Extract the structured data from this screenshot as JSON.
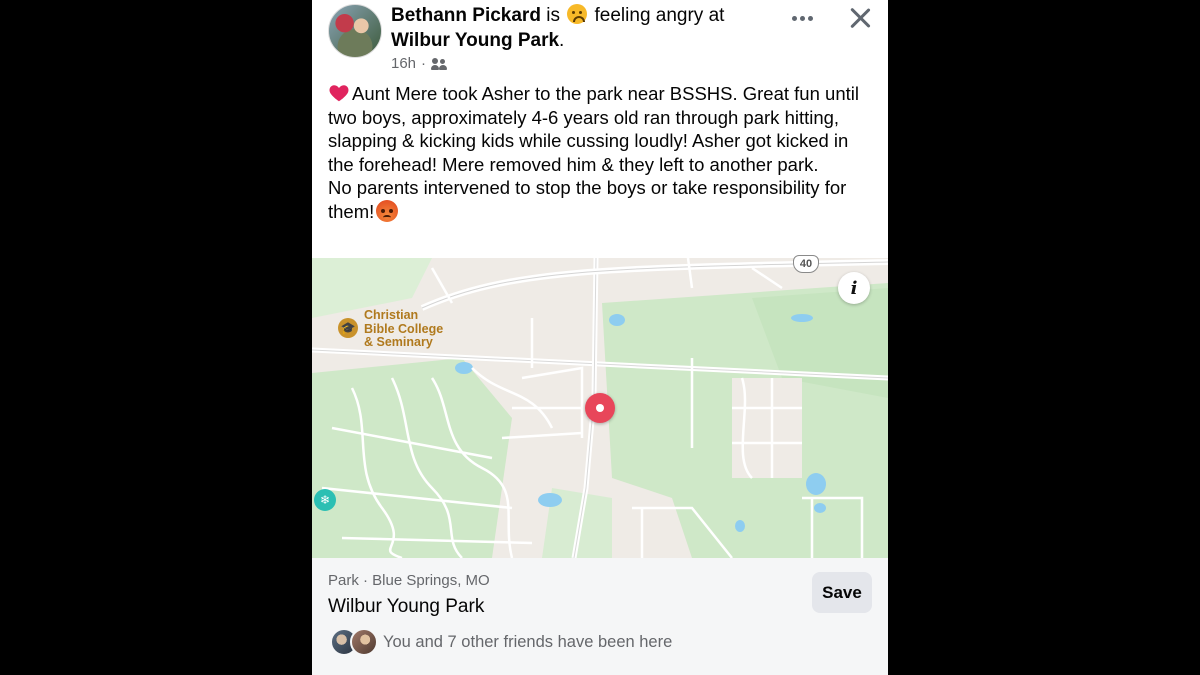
{
  "post": {
    "author": "Bethann Pickard",
    "verb_is": "is",
    "feeling_text": "feeling angry at",
    "location": "Wilbur Young Park",
    "location_suffix": ".",
    "time": "16h",
    "separator": "·",
    "audience_icon": "friends-icon",
    "paragraph1": "Aunt Mere took Asher to the park near BSSHS. Great fun until two boys, approximately 4-6 years old ran through park hitting, slapping & kicking kids while cussing loudly! Asher got kicked in the forehead!  Mere removed him & they left to another park.",
    "paragraph2": "No parents intervened to stop the boys or take responsibility for them!"
  },
  "map": {
    "poi_line1": "Christian",
    "poi_line2": "Bible College",
    "poi_line3": "& Seminary",
    "highway_shield": "40",
    "info_label": "i",
    "accent_pin": "#e8465a"
  },
  "place": {
    "category": "Park · Blue Springs, MO",
    "name": "Wilbur Young Park",
    "save_label": "Save",
    "friends_text": "You and 7 other friends have been here"
  }
}
